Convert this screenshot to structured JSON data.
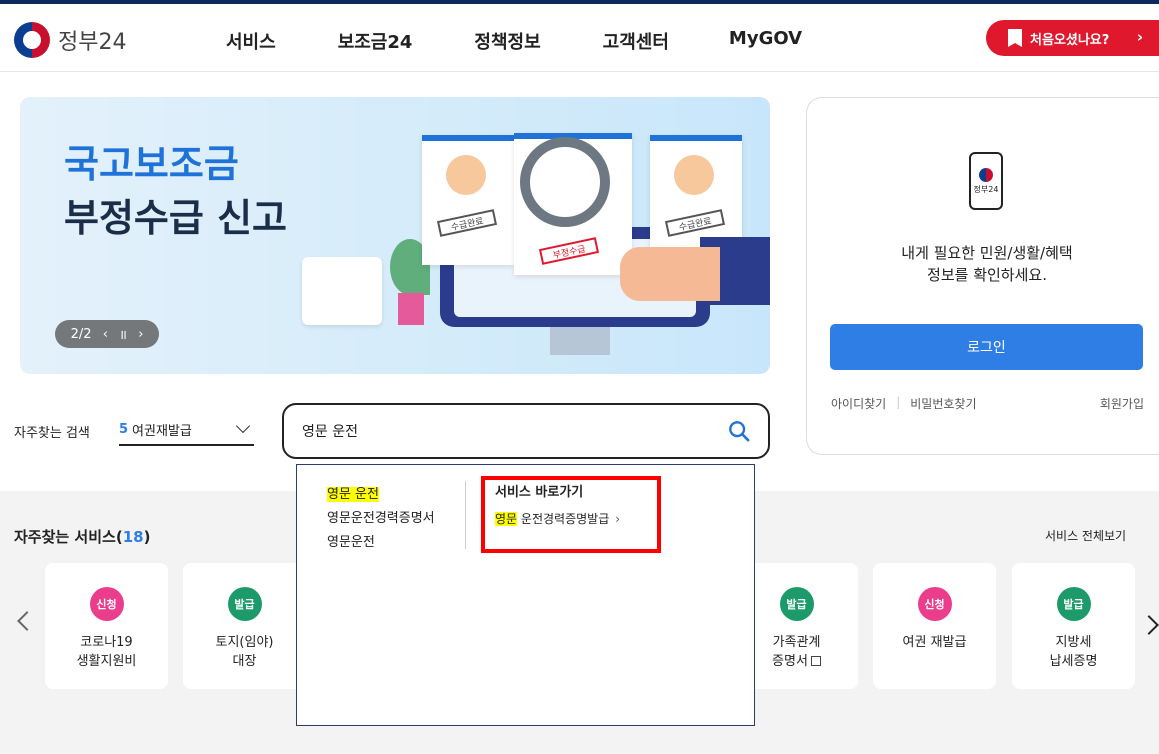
{
  "header": {
    "logo_text": "정부24",
    "nav": [
      "서비스",
      "보조금24",
      "정책정보",
      "고객센터",
      "MyGOV"
    ],
    "first_visit_label": "처음오셨나요?",
    "first_visit_chevron": "›"
  },
  "banner": {
    "title_line1": "국고보조금",
    "title_line2": "부정수급 신고",
    "stamp_small": "수급완료",
    "stamp_main": "부정수급",
    "pager": "2/2",
    "prev": "‹",
    "pause": "॥",
    "next": "›"
  },
  "login": {
    "phone_label": "정부24",
    "message_line1": "내게 필요한 민원/생활/혜택",
    "message_line2": "정보를 확인하세요.",
    "button": "로그인",
    "find_id": "아이디찾기",
    "separator": "|",
    "find_pw": "비밀번호찾기",
    "join": "회원가입"
  },
  "search": {
    "fav_label": "자주찾는 검색",
    "fav_rank": "5",
    "fav_keyword": "여권재발급",
    "query": "영문 운전"
  },
  "autocomplete": {
    "suggestions": [
      {
        "highlight": "영문 운전",
        "rest": ""
      },
      {
        "highlight": "",
        "rest": "영문운전경력증명서"
      },
      {
        "highlight": "",
        "rest": "영문운전"
      }
    ],
    "shortcut_heading": "서비스 바로가기",
    "shortcut_highlight": "영문",
    "shortcut_rest": " 운전경력증명발급",
    "shortcut_chevron": "›"
  },
  "frequent": {
    "title": "자주찾는 서비스",
    "count_open": "(",
    "count": "18",
    "count_close": ")",
    "all_link": "서비스 전체보기",
    "items": [
      {
        "badge": "신청",
        "color": "pink",
        "name": "코로나19\n생활지원비"
      },
      {
        "badge": "발급",
        "color": "green",
        "name": "토지(임야)\n대장"
      },
      {
        "badge": "발급",
        "color": "green",
        "name": "가족관계\n증명서"
      },
      {
        "badge": "신청",
        "color": "pink",
        "name": "여권 재발급"
      },
      {
        "badge": "발급",
        "color": "green",
        "name": "지방세\n납세증명"
      }
    ]
  },
  "colors": {
    "accent_blue": "#2f7ee6",
    "brand_red": "#e0182d",
    "highlight": "#ffff00",
    "annotation_box": "#ff0000"
  }
}
